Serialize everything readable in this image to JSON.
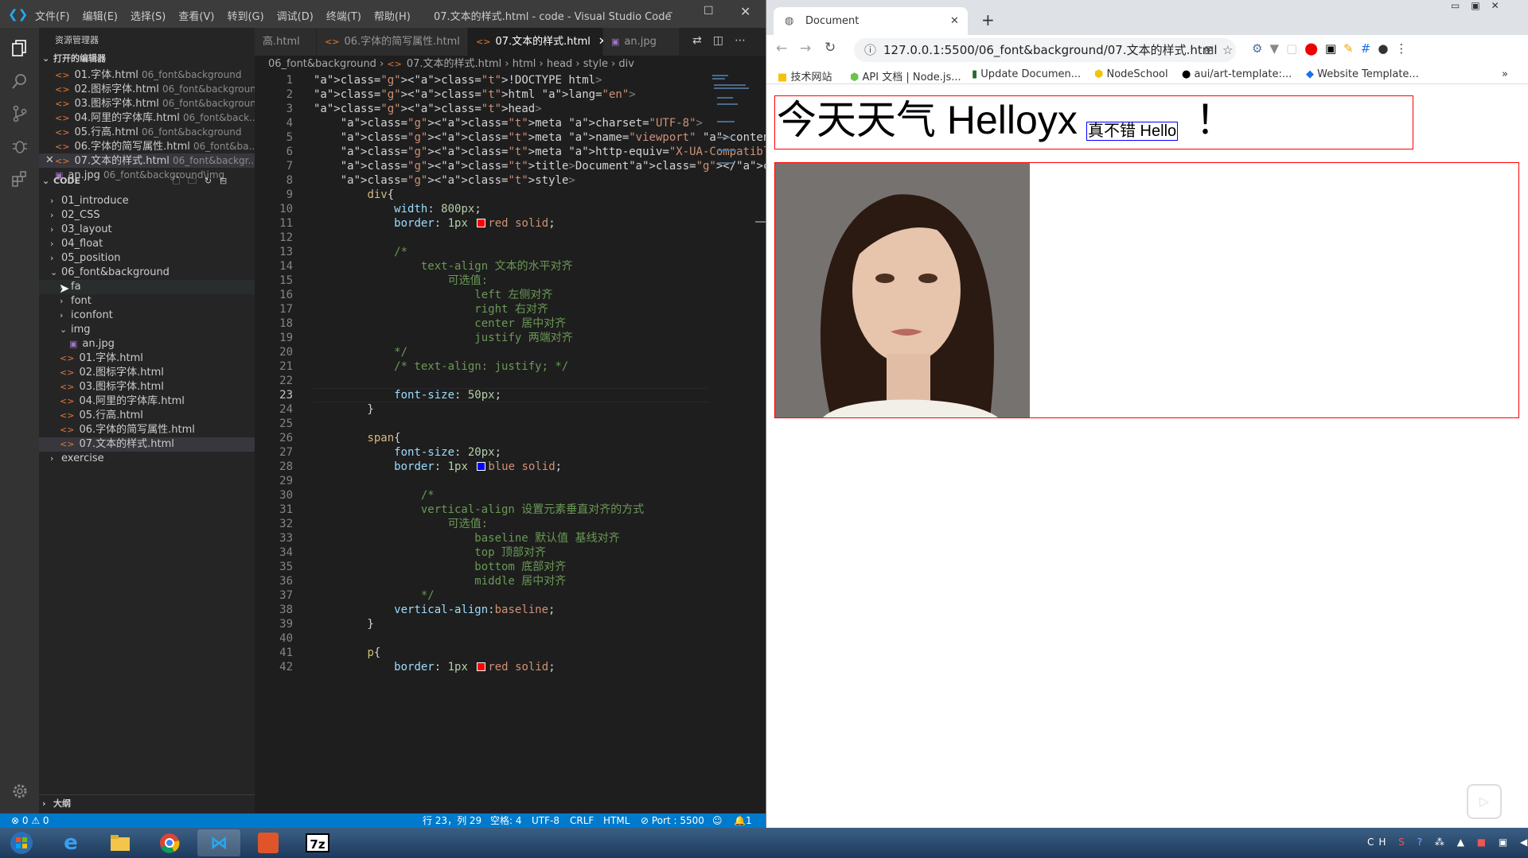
{
  "vscode": {
    "title": "07.文本的样式.html - code - Visual Studio Code",
    "menu": [
      "文件(F)",
      "编辑(E)",
      "选择(S)",
      "查看(V)",
      "转到(G)",
      "调试(D)",
      "终端(T)",
      "帮助(H)"
    ],
    "explorer_title": "资源管理器",
    "open_editors_label": "打开的编辑器",
    "open_editors": [
      {
        "name": "01.字体.html",
        "path": "06_font&background"
      },
      {
        "name": "02.图标字体.html",
        "path": "06_font&background"
      },
      {
        "name": "03.图标字体.html",
        "path": "06_font&background"
      },
      {
        "name": "04.阿里的字体库.html",
        "path": "06_font&back..."
      },
      {
        "name": "05.行高.html",
        "path": "06_font&background"
      },
      {
        "name": "06.字体的简写属性.html",
        "path": "06_font&ba..."
      },
      {
        "name": "07.文本的样式.html",
        "path": "06_font&backgr..."
      },
      {
        "name": "an.jpg",
        "path": "06_font&background\\img"
      }
    ],
    "workspace_label": "CODE",
    "tree_top": [
      "01_introduce",
      "02_CSS",
      "03_layout",
      "04_float",
      "05_position",
      "06_font&background"
    ],
    "tree_sub": [
      "fa",
      "font",
      "iconfont",
      "img"
    ],
    "tree_img_file": "an.jpg",
    "tree_files": [
      "01.字体.html",
      "02.图标字体.html",
      "03.图标字体.html",
      "04.阿里的字体库.html",
      "05.行高.html",
      "06.字体的简写属性.html",
      "07.文本的样式.html"
    ],
    "tree_last": "exercise",
    "outline_label": "大纲",
    "tabs": [
      "高.html",
      "06.字体的简写属性.html",
      "07.文本的样式.html",
      "an.jpg"
    ],
    "breadcrumb": [
      "06_font&background",
      "07.文本的样式.html",
      "html",
      "head",
      "style",
      "div"
    ],
    "status": {
      "problems": "0",
      "warnings": "0",
      "position": "行 23，列 29",
      "spaces": "空格: 4",
      "encoding": "UTF-8",
      "eol": "CRLF",
      "lang": "HTML",
      "port": "Port : 5500",
      "notif": "1"
    }
  },
  "code_lines": [
    "<!DOCTYPE html>",
    "<html lang=\"en\">",
    "<head>",
    "    <meta charset=\"UTF-8\">",
    "    <meta name=\"viewport\" content=\"width=device-width, in",
    "    <meta http-equiv=\"X-UA-Compatible\" content=\"ie=edge\">",
    "    <title>Document</title>",
    "    <style>",
    "        div{",
    "            width: 800px;",
    "            border: 1px red solid;",
    "",
    "            /*",
    "                text-align 文本的水平对齐",
    "                    可选值:",
    "                        left 左侧对齐",
    "                        right 右对齐",
    "                        center 居中对齐",
    "                        justify 两端对齐",
    "            */",
    "            /* text-align: justify; */",
    "",
    "            font-size: 50px;",
    "        }",
    "",
    "        span{",
    "            font-size: 20px;",
    "            border: 1px blue solid;",
    "",
    "                /*",
    "                vertical-align 设置元素垂直对齐的方式",
    "                    可选值:",
    "                        baseline 默认值 基线对齐",
    "                        top 顶部对齐",
    "                        bottom 底部对齐",
    "                        middle 居中对齐",
    "                */",
    "            vertical-align:baseline;",
    "        }",
    "",
    "        p{",
    "            border: 1px red solid;"
  ],
  "browser": {
    "tab_title": "Document",
    "url": "127.0.0.1:5500/06_font&background/07.文本的样式.html",
    "bookmarks": [
      "技术网站",
      "API 文档 | Node.js...",
      "Update Documen...",
      "NodeSchool",
      "aui/art-template:...",
      "Website Template..."
    ],
    "page": {
      "div_text": "今天天气 Helloyx",
      "span_text": "真不错 Hello",
      "exclaim": "！"
    }
  },
  "taskbar": {
    "tray_lang": "CH"
  }
}
